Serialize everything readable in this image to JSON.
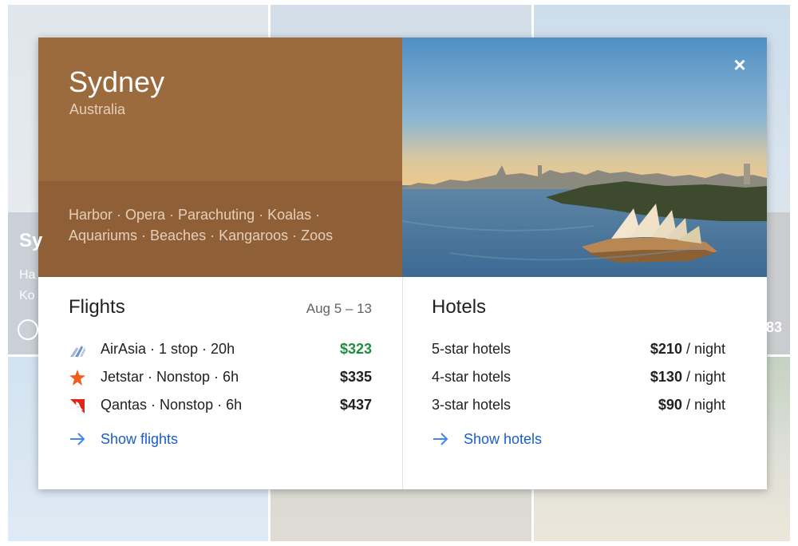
{
  "background": {
    "tile_title": "Sy",
    "tile_lines": [
      "Ha",
      "Ko"
    ],
    "tile_number": "83"
  },
  "destination": {
    "city": "Sydney",
    "country": "Australia",
    "tags": "Harbor · Opera · Parachuting · Koalas · Aquariums · Beaches · Kangaroos · Zoos",
    "hero_color": "#9b6b3e"
  },
  "close_icon": "×",
  "flights": {
    "title": "Flights",
    "dates": "Aug 5 – 13",
    "items": [
      {
        "airline": "AirAsia · 1 stop · 20h",
        "price": "$323",
        "icon": "airasia-logo-icon",
        "cheapest": true
      },
      {
        "airline": "Jetstar · Nonstop · 6h",
        "price": "$335",
        "icon": "jetstar-star-icon",
        "cheapest": false
      },
      {
        "airline": "Qantas · Nonstop · 6h",
        "price": "$437",
        "icon": "qantas-kangaroo-icon",
        "cheapest": false
      }
    ],
    "link": "Show flights"
  },
  "hotels": {
    "title": "Hotels",
    "items": [
      {
        "category": "5-star hotels",
        "price": "$210",
        "unit": " / night"
      },
      {
        "category": "4-star hotels",
        "price": "$130",
        "unit": " / night"
      },
      {
        "category": "3-star hotels",
        "price": "$90",
        "unit": " / night"
      }
    ],
    "link": "Show hotels"
  },
  "colors": {
    "link": "#1a5ec7",
    "cheapest_price": "#1e8e3e"
  }
}
